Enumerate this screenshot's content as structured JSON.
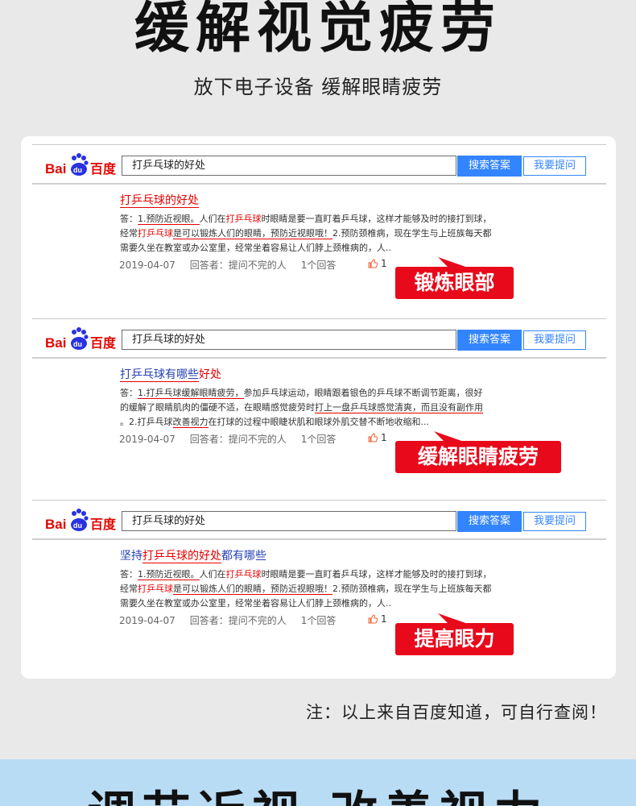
{
  "headline": "缓解视觉疲劳",
  "subheadline": "放下电子设备  缓解眼睛疲劳",
  "search": {
    "logo_text": "Bai百度",
    "query": "打乒乓球的好处",
    "search_button": "搜索答案",
    "ask_button": "我要提问"
  },
  "results": [
    {
      "title_parts": [
        {
          "text": "打乒乓球的好处",
          "style": "red-ul"
        }
      ],
      "body_lines": [
        [
          {
            "text": "答："
          },
          {
            "text": "1.预防近视眼。",
            "style": "u"
          },
          {
            "text": "人们在"
          },
          {
            "text": "打乒乓球",
            "style": "red"
          },
          {
            "text": "时眼睛是要一直盯着乒乓球，这样才能够及时的接打到球，"
          }
        ],
        [
          {
            "text": "经常"
          },
          {
            "text": "打乒乓球",
            "style": "red"
          },
          {
            "text": "是可以锻炼人们的眼睛，预防近视眼哦！",
            "style": "u"
          },
          {
            "text": "2.预防颈椎病，现在学生与上班族每天都"
          }
        ],
        [
          {
            "text": "需要久坐在教室或办公室里，经常坐着容易让人们脖上颈椎病的，人.."
          }
        ]
      ],
      "date": "2019-04-07",
      "answerer": "回答者：提问不完的人",
      "answers": "1个回答",
      "likes": "1",
      "callout": "锻炼眼部"
    },
    {
      "title_parts": [
        {
          "text": "打乒乓球有哪些",
          "style": "blue-ul"
        },
        {
          "text": "好处",
          "style": "red"
        }
      ],
      "body_lines": [
        [
          {
            "text": "答："
          },
          {
            "text": "1.打乒乓球缓解眼睛疲劳，",
            "style": "u"
          },
          {
            "text": "参加乒乓球运动，眼睛跟着银色的乒乓球不断调节距离，很好"
          }
        ],
        [
          {
            "text": "的缓解了眼睛肌肉的僵硬不适，在眼睛感觉疲劳时"
          },
          {
            "text": "打上一盘乒乓球感觉清爽，而且没有副作用",
            "style": "u"
          }
        ],
        [
          {
            "text": "。2.打乒乓球"
          },
          {
            "text": "改善视力",
            "style": "u"
          },
          {
            "text": "在打球的过程中眼睫状肌和眼球外肌交替不断地收缩和..."
          }
        ]
      ],
      "date": "2019-04-07",
      "answerer": "回答者：提问不完的人",
      "answers": "1个回答",
      "likes": "1",
      "callout": "缓解眼睛疲劳"
    },
    {
      "title_parts": [
        {
          "text": "坚持",
          "style": "blue"
        },
        {
          "text": "打乒乓球的好处",
          "style": "red-ul"
        },
        {
          "text": "都有哪些",
          "style": "blue"
        }
      ],
      "body_lines": [
        [
          {
            "text": "答："
          },
          {
            "text": "1.预防近视眼。",
            "style": "u"
          },
          {
            "text": "人们在"
          },
          {
            "text": "打乒乓球",
            "style": "red"
          },
          {
            "text": "时眼睛是要一直盯着乒乓球，这样才能够及时的接打到球，"
          }
        ],
        [
          {
            "text": "经常"
          },
          {
            "text": "打乒乓球",
            "style": "red"
          },
          {
            "text": "是可以锻炼人们的眼睛，预防近视眼哦！",
            "style": "u"
          },
          {
            "text": "2.预防颈椎病，现在学生与上班族每天都"
          }
        ],
        [
          {
            "text": "需要久坐在教室或办公室里，经常坐着容易让人们脖上颈椎病的，人.."
          }
        ]
      ],
      "date": "2019-04-07",
      "answerer": "回答者：提问不完的人",
      "answers": "1个回答",
      "likes": "1",
      "callout": "提高眼力"
    }
  ],
  "note": "注：以上来自百度知道，可自行查阅！",
  "footer_heading": "调节近视 改善视力",
  "colors": {
    "baidu_blue": "#3385ff",
    "baidu_red": "#e10602",
    "callout_red": "#e8091b",
    "footer_band": "#b9dcf5"
  }
}
